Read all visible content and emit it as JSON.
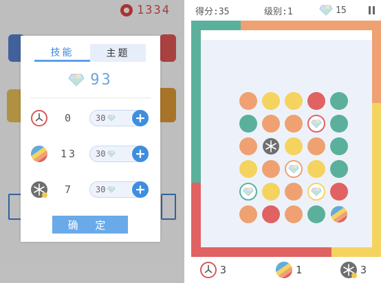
{
  "left": {
    "background_score": "1334",
    "dialog": {
      "tabs": [
        {
          "label": "技能",
          "active": true
        },
        {
          "label": "主题",
          "active": false
        }
      ],
      "gem_balance": "93",
      "props": [
        {
          "icon": "clock-icon",
          "count": "0",
          "price": "30"
        },
        {
          "icon": "rainbow-ball-icon",
          "count": "13",
          "price": "30"
        },
        {
          "icon": "snowflake-icon",
          "count": "7",
          "price": "30"
        }
      ],
      "confirm_label": "确 定"
    }
  },
  "right": {
    "hud": {
      "score_text": "得分:35",
      "level_text": "级别:1",
      "gems": "15"
    },
    "board": {
      "rows": [
        [
          "orange",
          "yellow",
          "yellow",
          "red",
          "teal"
        ],
        [
          "teal",
          "orange",
          "orange",
          "gem-red",
          "teal"
        ],
        [
          "orange",
          "snowflake",
          "yellow",
          "orange",
          "teal"
        ],
        [
          "yellow",
          "orange",
          "gem-orange",
          "yellow",
          "teal"
        ],
        [
          "gem-teal",
          "yellow",
          "orange",
          "gem-yellow",
          "red"
        ],
        [
          "orange",
          "red",
          "orange",
          "teal",
          "rainbow"
        ]
      ]
    },
    "bottom_props": [
      {
        "icon": "clock-icon",
        "count": "3"
      },
      {
        "icon": "rainbow-ball-icon",
        "count": "1"
      },
      {
        "icon": "snowflake-icon",
        "count": "3"
      }
    ]
  },
  "colors": {
    "orange": "#efa172",
    "yellow": "#f5d35f",
    "red": "#e06262",
    "teal": "#5bb09c",
    "accent_blue": "#3e8ee0"
  }
}
